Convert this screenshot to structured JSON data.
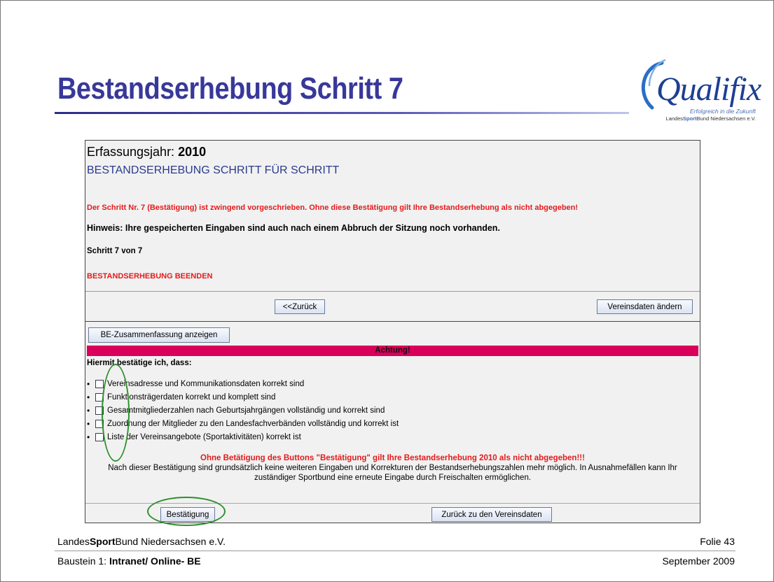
{
  "slide": {
    "title": "Bestandserhebung Schritt 7",
    "logo": {
      "word": "Qualifix",
      "tagline": "Erfolgreich in die Zukunft",
      "org_prefix": "Landes",
      "org_bold": "Sport",
      "org_suffix": "Bund Niedersachsen e.V."
    },
    "footer": {
      "org_prefix": "Landes",
      "org_bold": "Sport",
      "org_suffix": "Bund Niedersachsen e.V.",
      "slide_number": "Folie 43",
      "module_prefix": "Baustein 1: ",
      "module_bold": "Intranet/ Online- BE",
      "date": "September 2009"
    },
    "colors": {
      "title": "#38389a",
      "warning_red": "#e31b1b",
      "achtung_bar": "#d8005a",
      "annotation_green": "#2f8f2f"
    }
  },
  "app": {
    "year_label": "Erfassungsjahr: ",
    "year_value": "2010",
    "subheading": "BESTANDSERHEBUNG SCHRITT FÜR SCHRITT",
    "mandatory_warning": "Der Schritt Nr. 7 (Bestätigung) ist zwingend vorgeschrieben. Ohne diese Bestätigung gilt Ihre Bestandserhebung als nicht abgegeben!",
    "hint": "Hinweis: Ihre gespeicherten Eingaben sind auch nach einem Abbruch der Sitzung noch vorhanden.",
    "step": "Schritt 7 von 7",
    "finish_label": "BESTANDSERHEBUNG BEENDEN",
    "buttons": {
      "back": "<<Zurück",
      "edit_club_data": "Vereinsdaten ändern",
      "show_summary": "BE-Zusammenfassung anzeigen",
      "confirm": "Bestätigung",
      "back_to_club_data": "Zurück zu den Vereinsdaten"
    },
    "achtung": "Achtung!",
    "confirm_heading": "Hiermit bestätige ich, dass:",
    "checklist": [
      "Vereinsadresse und Kommunikationsdaten korrekt sind",
      "Funktionsträgerdaten korrekt und komplett sind",
      "Gesamtmitgliederzahlen nach Geburtsjahrgängen vollständig und korrekt sind",
      "Zuordnung der Mitglieder zu den Landesfachverbänden vollständig und korrekt ist",
      "Liste der Vereinsangebote (Sportaktivitäten) korrekt ist"
    ],
    "notice_red": "Ohne Betätigung des Buttons \"Bestätigung\" gilt Ihre Bestandserhebung 2010 als nicht abgegeben!!!",
    "notice_body": "Nach dieser Bestätigung sind grundsätzlich keine weiteren Eingaben und Korrekturen der Bestandserhebungszahlen mehr möglich. In Ausnahmefällen kann Ihr zuständiger Sportbund eine erneute Eingabe durch Freischalten ermöglichen."
  }
}
